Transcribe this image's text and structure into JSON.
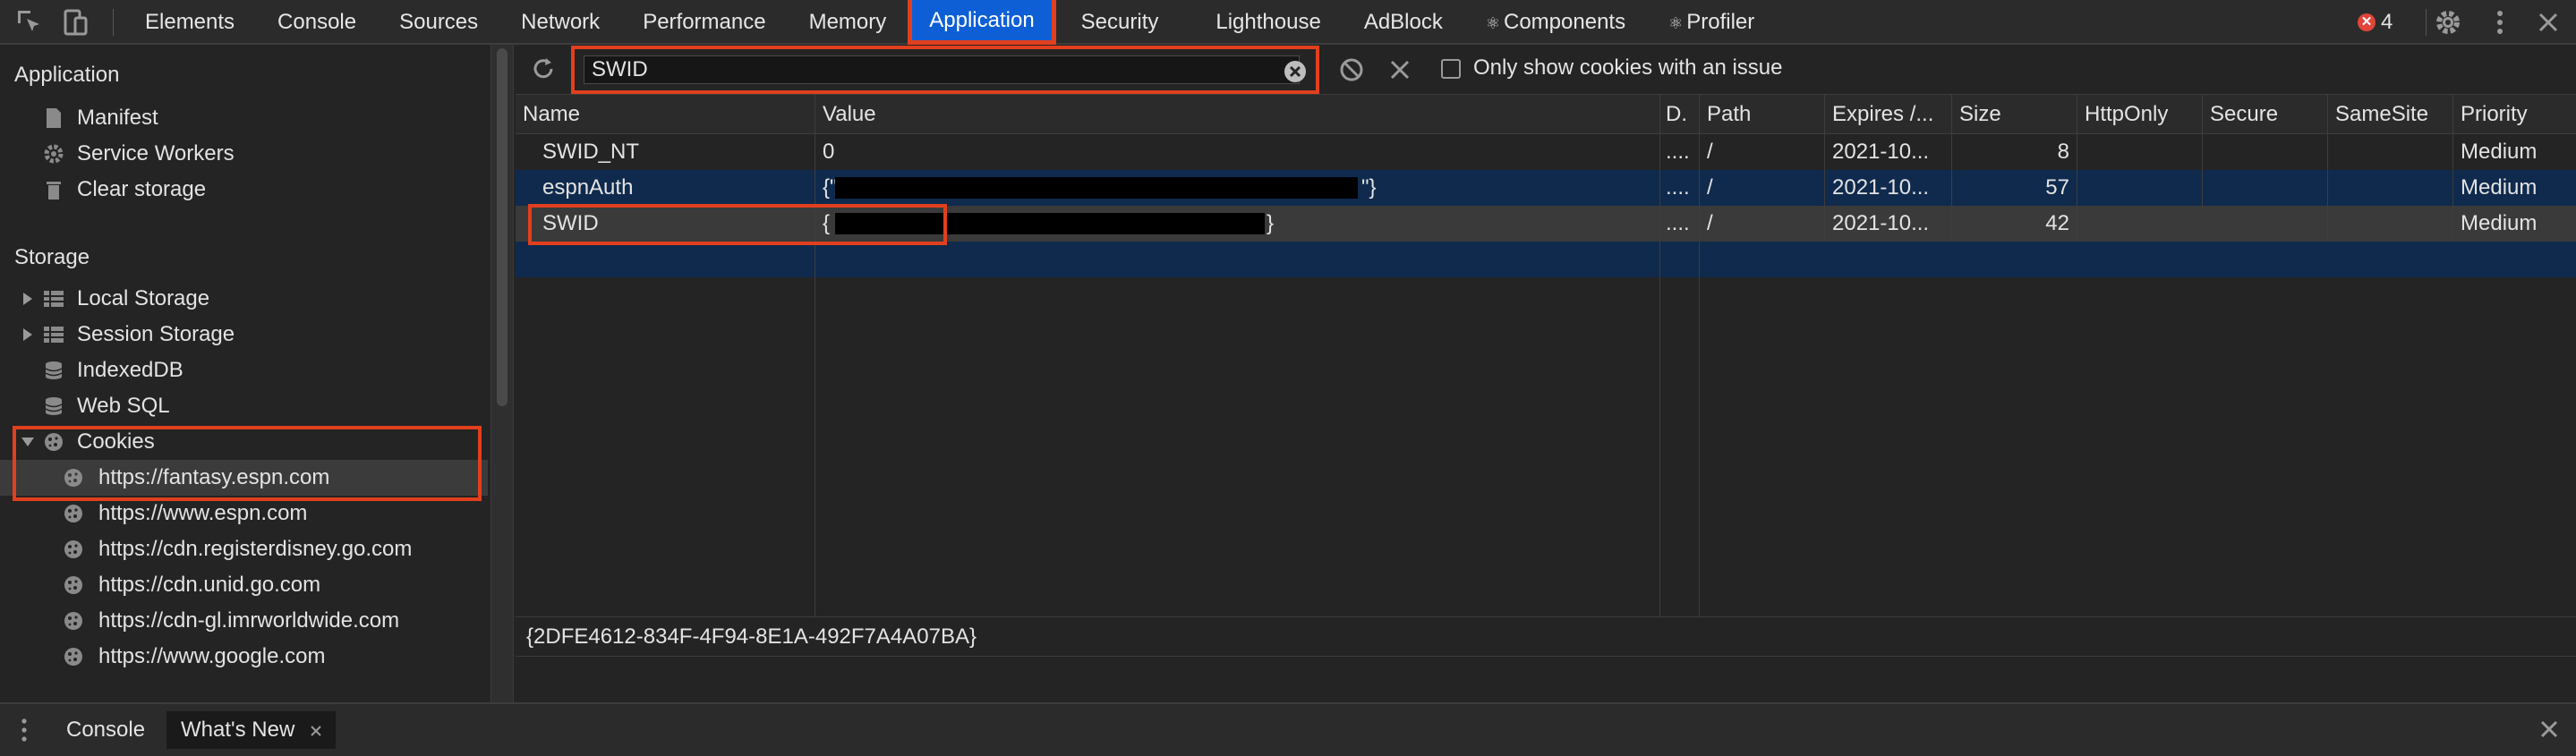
{
  "topbar": {
    "tabs": [
      {
        "label": "Elements"
      },
      {
        "label": "Console"
      },
      {
        "label": "Sources"
      },
      {
        "label": "Network"
      },
      {
        "label": "Performance"
      },
      {
        "label": "Memory"
      },
      {
        "label": "Application",
        "active": true
      },
      {
        "label": "Security"
      },
      {
        "label": "Lighthouse"
      },
      {
        "label": "AdBlock"
      },
      {
        "label": "Components",
        "icon": "react-icon"
      },
      {
        "label": "Profiler",
        "icon": "react-icon"
      }
    ],
    "error_count": "4",
    "icons": [
      "inspect-element-icon",
      "device-toolbar-icon",
      "settings-icon",
      "more-vert-icon",
      "close-icon"
    ]
  },
  "sidebar": {
    "application_header": "Application",
    "application_items": [
      "Manifest",
      "Service Workers",
      "Clear storage"
    ],
    "storage_header": "Storage",
    "storage_items": [
      "Local Storage",
      "Session Storage",
      "IndexedDB",
      "Web SQL",
      "Cookies"
    ],
    "cookie_domains": [
      "https://fantasy.espn.com",
      "https://www.espn.com",
      "https://cdn.registerdisney.go.com",
      "https://cdn.unid.go.com",
      "https://cdn-gl.imrworldwide.com",
      "https://www.google.com"
    ],
    "selected_domain": "https://fantasy.espn.com"
  },
  "toolbar": {
    "filter_value": "SWID",
    "issue_checkbox_label": "Only show cookies with an issue",
    "issue_checkbox_checked": false
  },
  "table": {
    "columns": [
      "Name",
      "Value",
      "D.",
      "Path",
      "Expires /...",
      "Size",
      "HttpOnly",
      "Secure",
      "SameSite",
      "Priority"
    ],
    "rows": [
      {
        "name": "SWID_NT",
        "value": "0",
        "domain": "....",
        "path": "/",
        "expires": "2021-10...",
        "size": "8",
        "httponly": "",
        "secure": "",
        "samesite": "",
        "priority": "Medium"
      },
      {
        "name": "espnAuth",
        "value_prefix": "{\"",
        "value_suffix": "\"}",
        "value_redacted": true,
        "domain": "....",
        "path": "/",
        "expires": "2021-10...",
        "size": "57",
        "httponly": "",
        "secure": "",
        "samesite": "",
        "priority": "Medium"
      },
      {
        "name": "SWID",
        "value_prefix": "{",
        "value_suffix": "}",
        "value_redacted": true,
        "domain": "....",
        "path": "/",
        "expires": "2021-10...",
        "size": "42",
        "httponly": "",
        "secure": "",
        "samesite": "",
        "priority": "Medium"
      }
    ],
    "selected_value": "{2DFE4612-834F-4F94-8E1A-492F7A4A07BA}"
  },
  "drawer": {
    "tabs": [
      {
        "label": "Console"
      },
      {
        "label": "What's New",
        "active": true
      }
    ]
  },
  "colors": {
    "active_tab": "#0e5fd6",
    "highlight_box": "#e13f1e",
    "error_badge": "#e0453a",
    "selected_row": "#0f2a4d",
    "background": "#242424"
  }
}
